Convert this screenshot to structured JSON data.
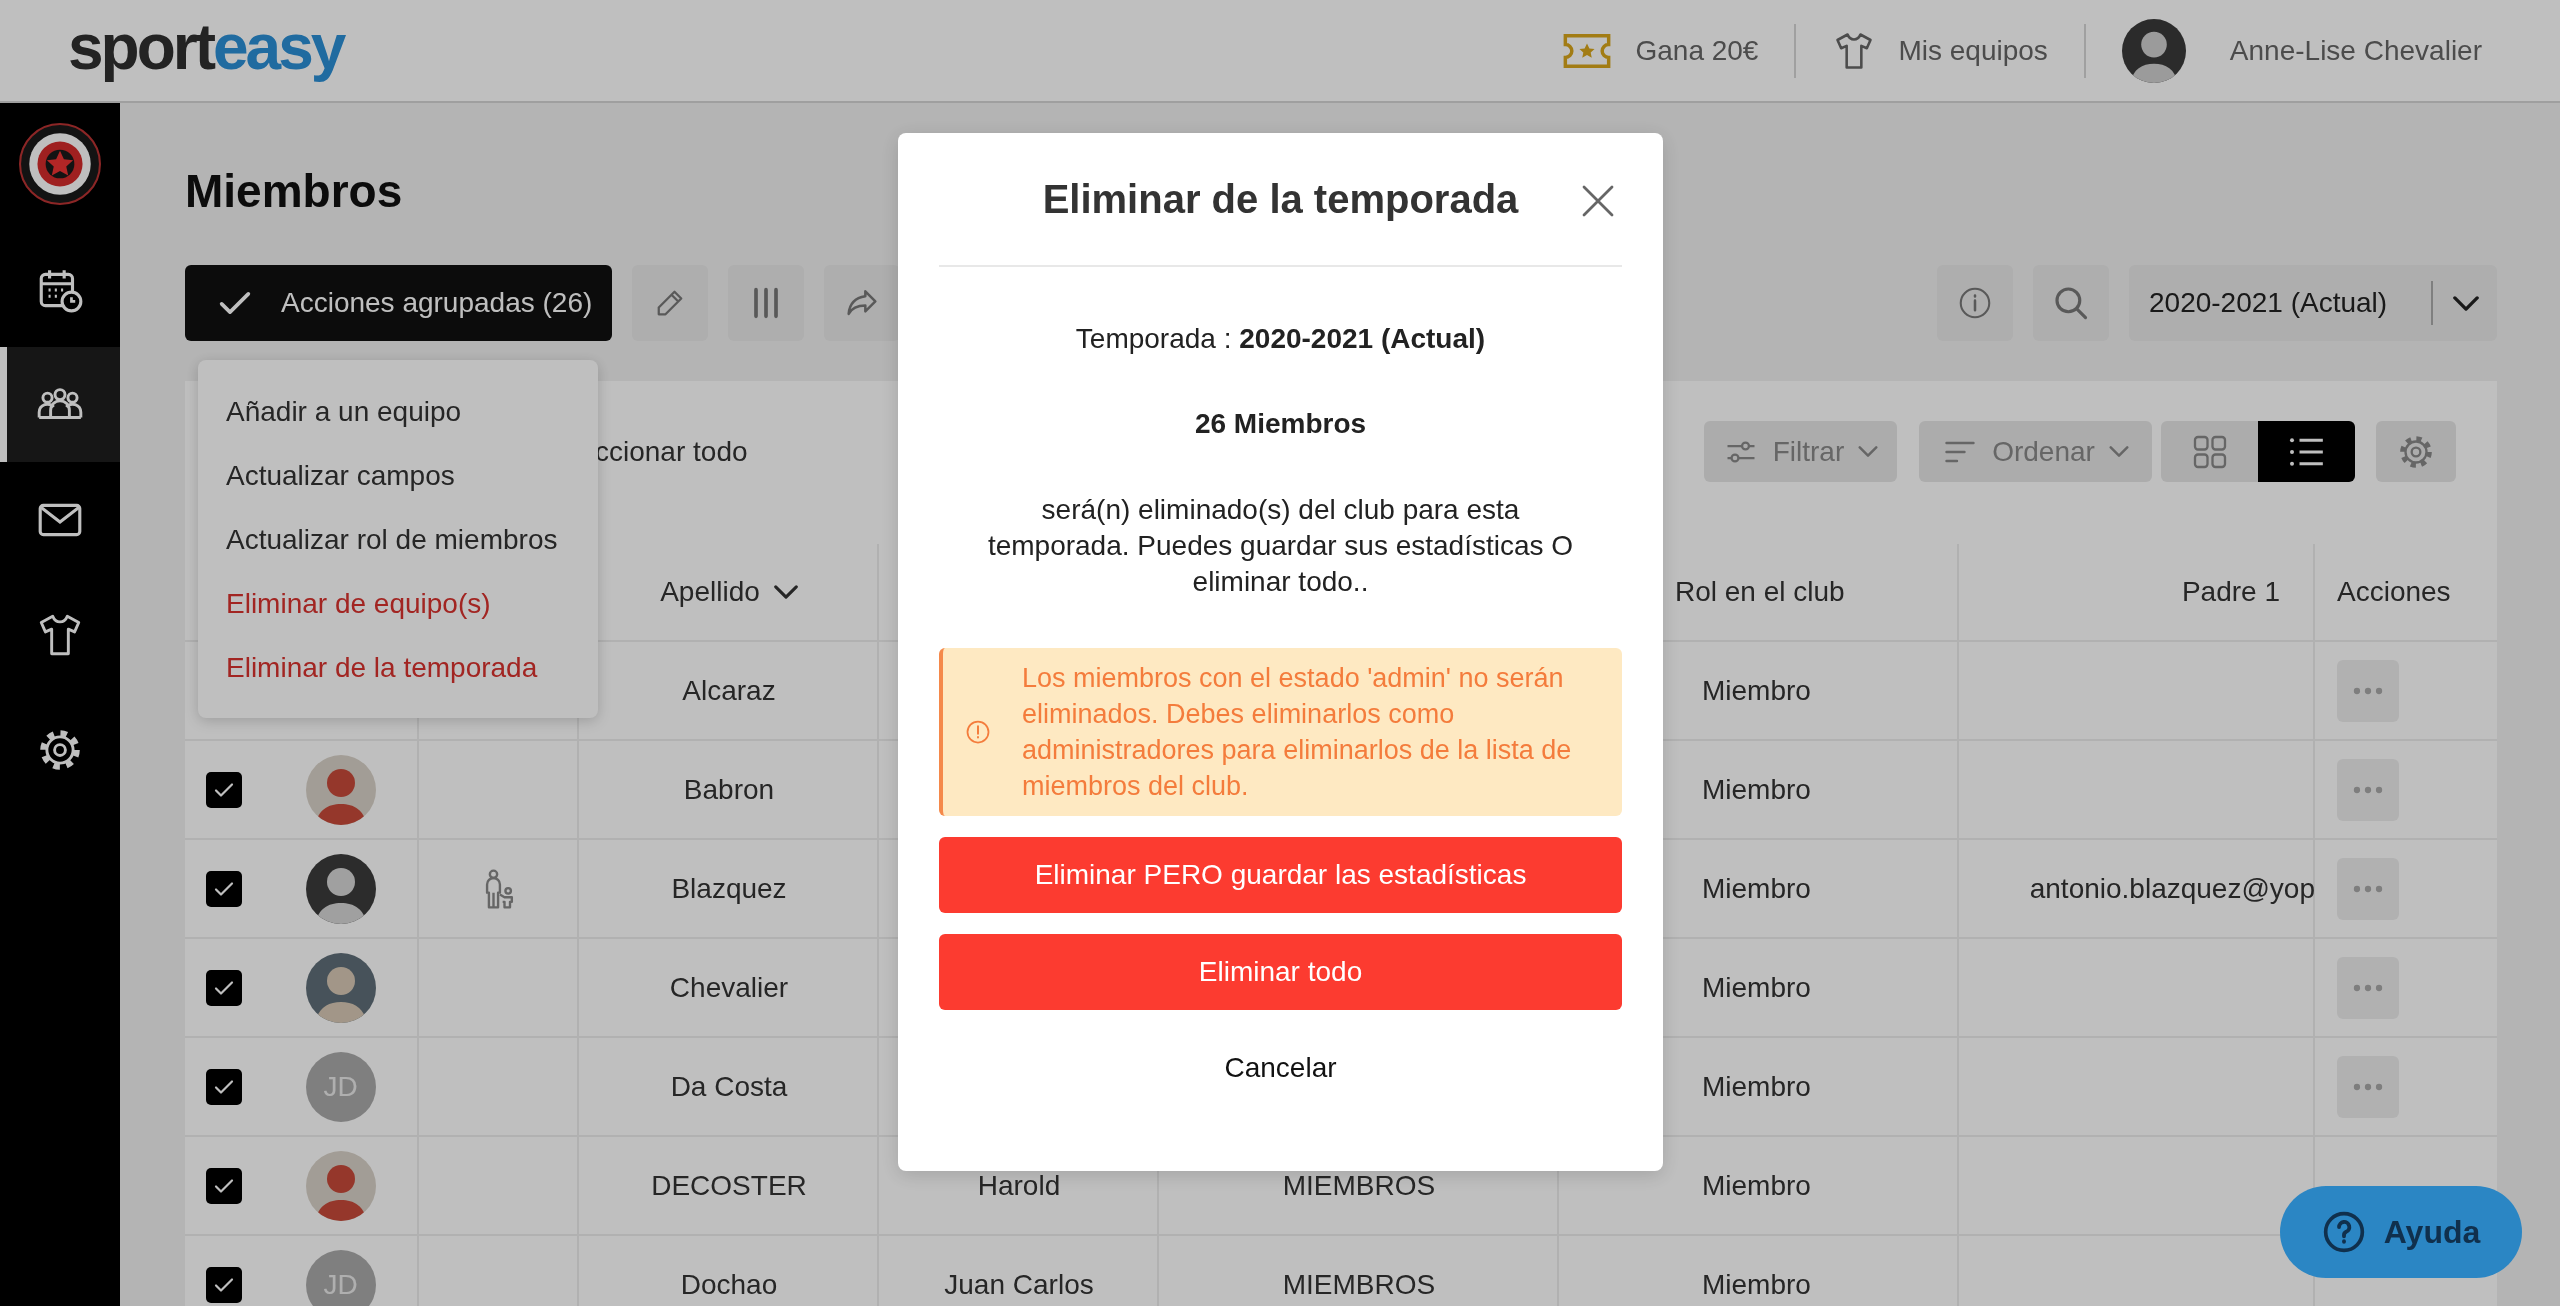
{
  "header": {
    "logo": [
      "sport",
      "easy"
    ],
    "links": [
      {
        "kind": "referral",
        "label": "Gana 20€"
      },
      {
        "kind": "teams",
        "label": "Mis equipos"
      }
    ],
    "user": {
      "name": "Anne-Lise Chevalier"
    }
  },
  "sidebar": {
    "items": [
      {
        "kind": "calendar",
        "selected": false
      },
      {
        "kind": "members",
        "selected": true
      },
      {
        "kind": "messages",
        "selected": false
      },
      {
        "kind": "teams",
        "selected": false
      },
      {
        "kind": "settings",
        "selected": false
      }
    ]
  },
  "page": {
    "title": "Miembros"
  },
  "toolbar": {
    "bulk_button": "Acciones agrupadas (26)",
    "season_select": {
      "value": "2020-2021 (Actual)"
    }
  },
  "filters": {
    "select_all_label": "ccionar todo",
    "filter_button": "Filtrar",
    "sort_button": "Ordenar",
    "view_modes": [
      {
        "kind": "grid",
        "selected": false
      },
      {
        "kind": "list",
        "selected": true
      }
    ]
  },
  "bulk_menu": {
    "items": [
      {
        "label": "Añadir a un equipo",
        "danger": false
      },
      {
        "label": "Actualizar campos",
        "danger": false
      },
      {
        "label": "Actualizar rol de miembros",
        "danger": false
      },
      {
        "label": "Eliminar de equipo(s)",
        "danger": true
      },
      {
        "label": "Eliminar de la temporada",
        "danger": true
      }
    ]
  },
  "table": {
    "columns": [
      {
        "label": "Apellido",
        "sort_indicator": true
      },
      {
        "label": "Rol en el club",
        "sort_indicator": false
      },
      {
        "label": "Padre 1",
        "sort_indicator": false
      },
      {
        "label": "Acciones",
        "sort_indicator": false
      }
    ],
    "rows": [
      {
        "apellido": "Alcaraz",
        "rol": "Miembro"
      },
      {
        "checked": true,
        "avatar": {
          "kind": "photo"
        },
        "linked_child": false,
        "apellido": "Babron",
        "rol": "Miembro"
      },
      {
        "checked": true,
        "avatar": {
          "kind": "photo"
        },
        "linked_child": true,
        "apellido": "Blazquez",
        "rol": "Miembro",
        "padre_1": "antonio.blazquez@yop"
      },
      {
        "checked": true,
        "avatar": {
          "kind": "photo"
        },
        "linked_child": false,
        "apellido": "Chevalier",
        "rol": "Miembro"
      },
      {
        "checked": true,
        "avatar": {
          "kind": "initials",
          "initials": "JD"
        },
        "linked_child": false,
        "apellido": "Da Costa",
        "rol": "Miembro"
      },
      {
        "checked": true,
        "avatar": {
          "kind": "photo"
        },
        "linked_child": false,
        "apellido": "DECOSTER",
        "nombre": "Harold",
        "column_5": "MIEMBROS",
        "rol": "Miembro"
      },
      {
        "checked": true,
        "avatar": {
          "kind": "initials",
          "initials": "JD"
        },
        "linked_child": false,
        "apellido": "Dochao",
        "nombre": "Juan Carlos",
        "column_5": "MIEMBROS",
        "rol": "Miembro"
      }
    ]
  },
  "modal": {
    "title": "Eliminar de la temporada",
    "season_line": "Temporada : **2020-2021 (Actual)**",
    "count": "26 Miembros",
    "message": "será(n) eliminado(s) del club para esta temporada. Puedes guardar sus estadísticas O eliminar todo..",
    "warning": "Los miembros con el estado 'admin' no serán eliminados. Debes eliminarlos como administradores para eliminarlos de la lista de miembros del club.",
    "actions": [
      {
        "kind": "danger",
        "label": "Eliminar PERO guardar las estadísticas"
      },
      {
        "kind": "danger",
        "label": "Eliminar todo"
      },
      {
        "kind": "plain",
        "label": "Cancelar"
      }
    ]
  },
  "help": {
    "label": "Ayuda"
  }
}
